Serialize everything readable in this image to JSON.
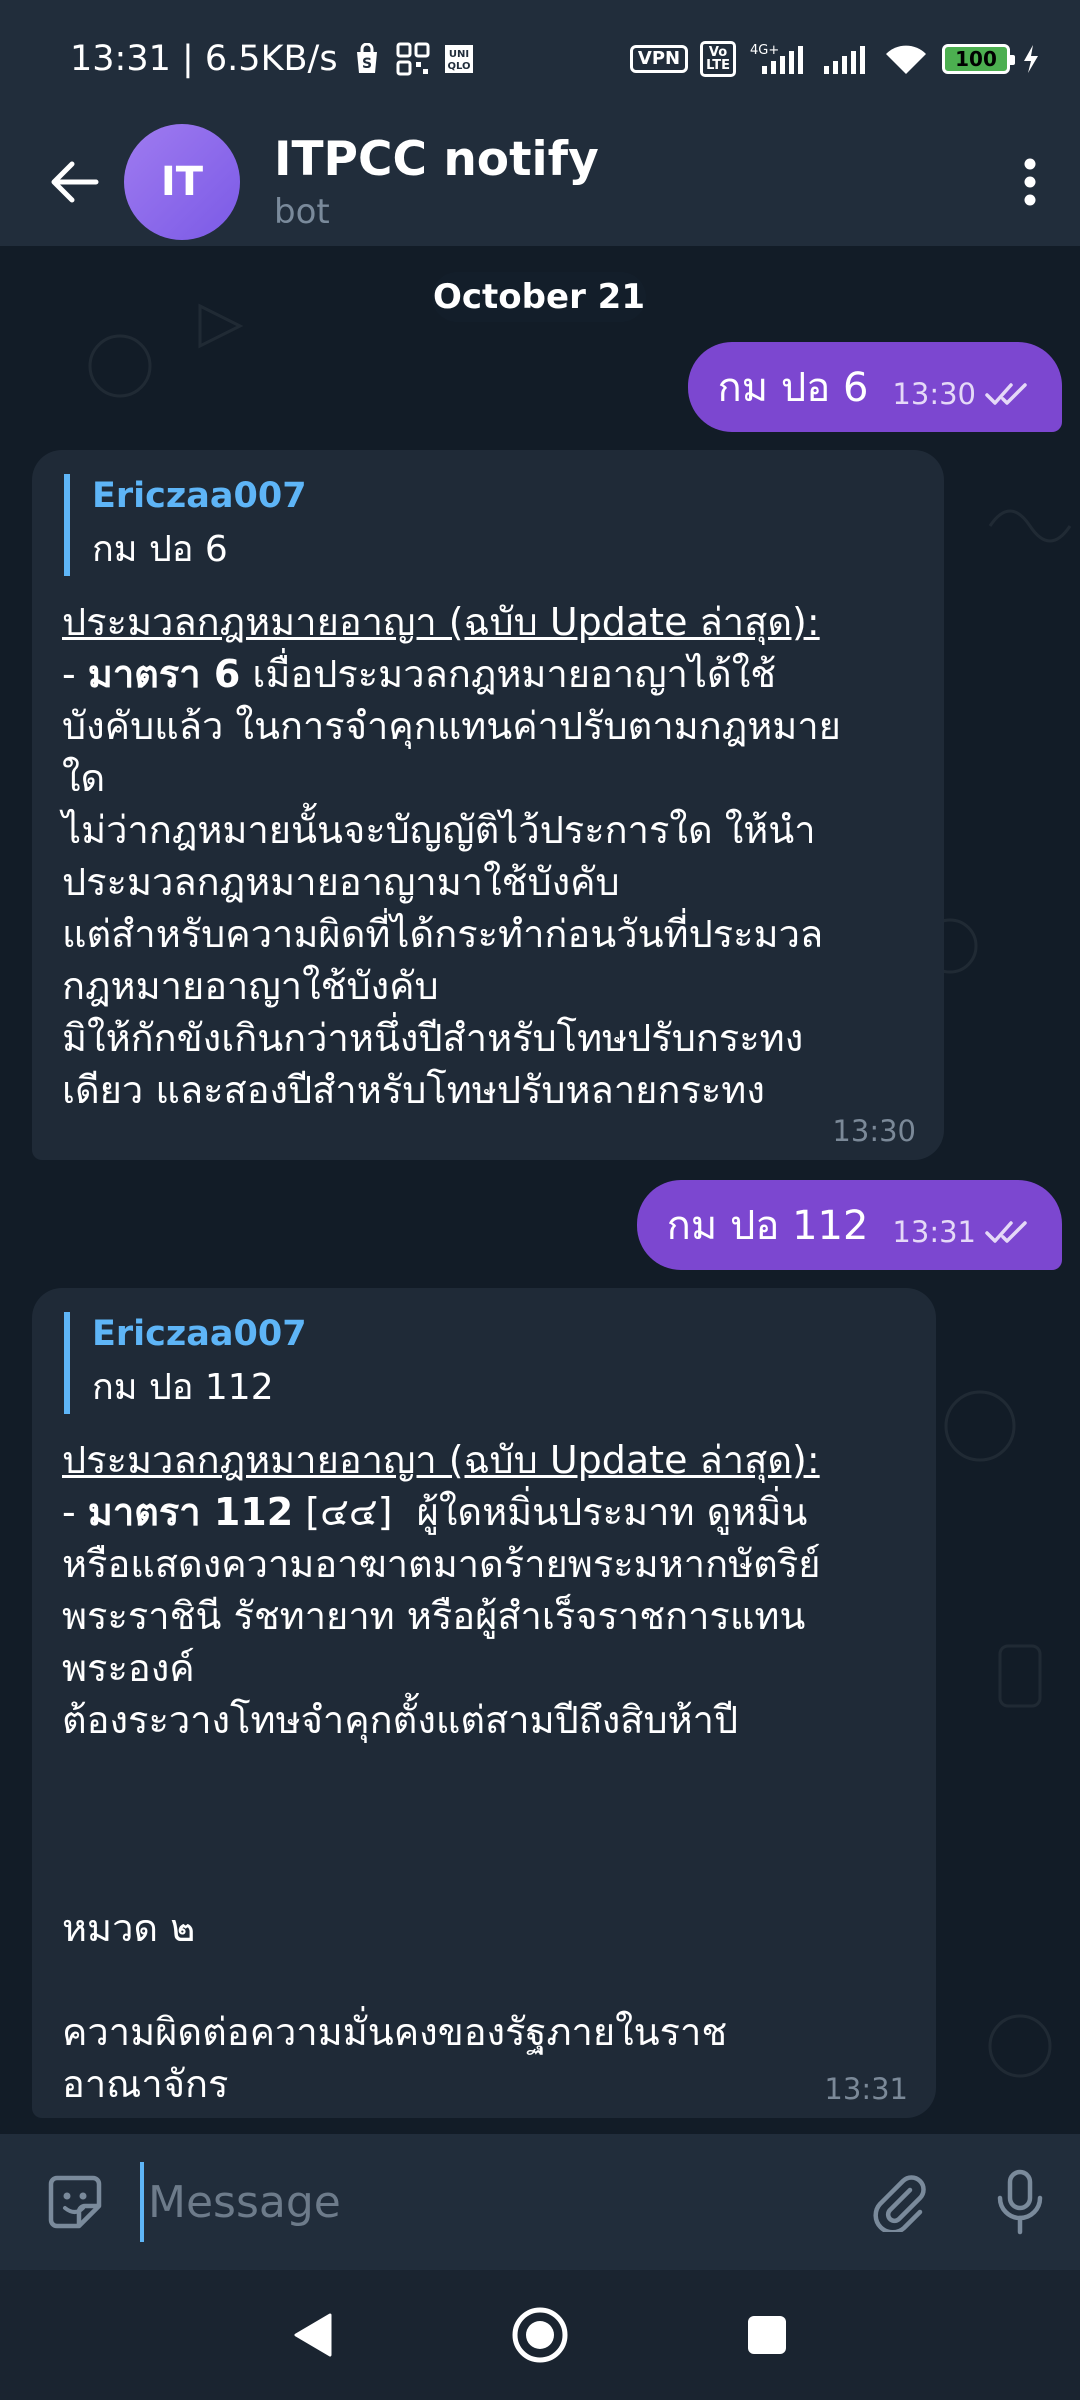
{
  "status_bar": {
    "time_speed": "13:31 | 6.5KB/s",
    "icons": [
      "shopping-bag-icon",
      "grid-icon",
      "uniqlo-icon"
    ],
    "vpn": "VPN",
    "volte": "Vo\nLTE",
    "network": "4G+",
    "battery": "100"
  },
  "header": {
    "avatar_initials": "IT",
    "title": "ITPCC notify",
    "subtitle": "bot",
    "avatar_color": "#8a66ec"
  },
  "chat": {
    "date": "October 21",
    "messages": [
      {
        "type": "out",
        "text": "กม ปอ 6",
        "time": "13:30"
      },
      {
        "type": "in",
        "reply_author": "Ericzaa007",
        "reply_text": "กม ปอ 6",
        "heading": "ประมวลกฎหมายอาญา (ฉบับ Update ล่าสุด):",
        "section_prefix": "- ",
        "section_bold": "มาตรา 6",
        "body": " เมื่อประมวลกฎหมายอาญาได้ใช้\nบังคับแล้ว ในการจำคุกแทนค่าปรับตามกฎหมาย\nใด\nไม่ว่ากฎหมายนั้นจะบัญญัติไว้ประการใด ให้นำ\nประมวลกฎหมายอาญามาใช้บังคับ\nแต่สำหรับความผิดที่ได้กระทำก่อนวันที่ประมวล\nกฎหมายอาญาใช้บังคับ\nมิให้กักขังเกินกว่าหนึ่งปีสำหรับโทษปรับกระทง\nเดียว และสองปีสำหรับโทษปรับหลายกระทง",
        "time": "13:30"
      },
      {
        "type": "out",
        "text": "กม ปอ 112",
        "time": "13:31"
      },
      {
        "type": "in",
        "reply_author": "Ericzaa007",
        "reply_text": "กม ปอ 112",
        "heading": "ประมวลกฎหมายอาญา (ฉบับ Update ล่าสุด):",
        "section_prefix": "- ",
        "section_bold": "มาตรา 112",
        "body": " [๔๔]  ผู้ใดหมิ่นประมาท ดูหมิ่น\nหรือแสดงความอาฆาตมาดร้ายพระมหากษัตริย์\nพระราชินี รัชทายาท หรือผู้สำเร็จราชการแทน\nพระองค์\nต้องระวางโทษจำคุกตั้งแต่สามปีถึงสิบห้าปี\n\n\n\nหมวด ๒\n\nความผิดต่อความมั่นคงของรัฐภายในราช\nอาณาจักร",
        "time": "13:31"
      }
    ]
  },
  "composer": {
    "placeholder": "Message"
  },
  "colors": {
    "outgoing_bubble": "#7c47d0",
    "incoming_bubble": "#1f2a37",
    "accent": "#5eb5f7",
    "background": "#0e1621"
  }
}
